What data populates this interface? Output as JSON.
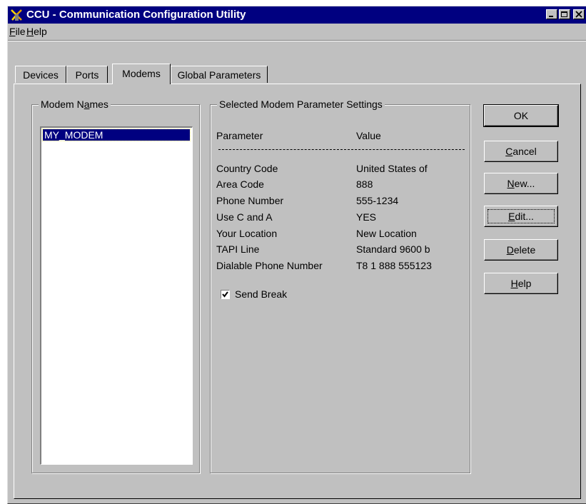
{
  "window": {
    "title": "CCU - Communication Configuration Utility",
    "colors": {
      "titlebar": "#000080",
      "face": "#c0c0c0",
      "selection": "#000080"
    }
  },
  "menu": {
    "file": {
      "accel": "F",
      "rest": "ile"
    },
    "help": {
      "accel": "H",
      "rest": "elp"
    }
  },
  "tabs": [
    "Devices",
    "Ports",
    "Modems",
    "Global Parameters"
  ],
  "active_tab": "Modems",
  "modem_names": {
    "legend_pre": "Modem N",
    "legend_accel": "a",
    "legend_post": "mes",
    "items": [
      "MY_MODEM"
    ],
    "selected": "MY_MODEM"
  },
  "settings": {
    "legend": "Selected Modem Parameter Settings",
    "header_param": "Parameter",
    "header_value": "Value",
    "rows": [
      {
        "param": "Country Code",
        "value": "United States of"
      },
      {
        "param": "Area Code",
        "value": "888"
      },
      {
        "param": "Phone Number",
        "value": "555-1234"
      },
      {
        "param": "Use C and A",
        "value": "YES"
      },
      {
        "param": "Your Location",
        "value": "New Location"
      },
      {
        "param": "TAPI Line",
        "value": "Standard  9600 b"
      },
      {
        "param": "Dialable Phone Number",
        "value": "T8  1 888 555123"
      }
    ],
    "send_break": {
      "label": "Send Break",
      "checked": true
    }
  },
  "buttons": {
    "ok": {
      "pre": "",
      "accel": "",
      "post": "OK"
    },
    "cancel": {
      "pre": "",
      "accel": "C",
      "post": "ancel"
    },
    "new": {
      "pre": "",
      "accel": "N",
      "post": "ew..."
    },
    "edit": {
      "pre": "",
      "accel": "E",
      "post": "dit..."
    },
    "delete": {
      "pre": "",
      "accel": "D",
      "post": "elete"
    },
    "help": {
      "pre": "",
      "accel": "H",
      "post": "elp"
    }
  }
}
